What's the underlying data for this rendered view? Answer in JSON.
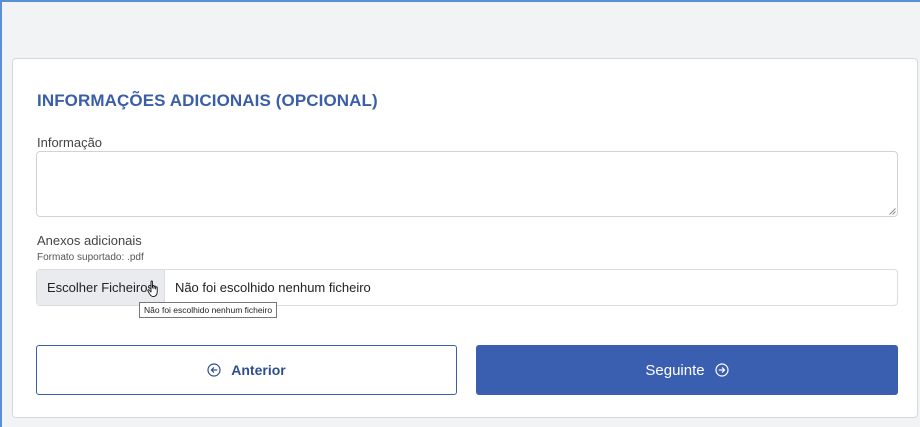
{
  "section": {
    "title": "INFORMAÇÕES ADICIONAIS (OPCIONAL)"
  },
  "info_field": {
    "label": "Informação",
    "value": ""
  },
  "attachments": {
    "label": "Anexos adicionais",
    "hint": "Formato suportado: .pdf",
    "button_label": "Escolher Ficheiros",
    "status": "Não foi escolhido nenhum ficheiro",
    "tooltip": "Não foi escolhido nenhum ficheiro"
  },
  "nav": {
    "prev_label": "Anterior",
    "next_label": "Seguinte"
  },
  "colors": {
    "accent": "#3a5fb0",
    "title": "#3a5ea8"
  },
  "icons": {
    "prev": "circle-arrow-left-icon",
    "next": "circle-arrow-right-icon",
    "cursor": "hand-pointer-icon"
  }
}
